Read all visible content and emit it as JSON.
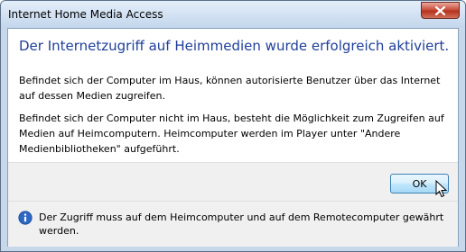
{
  "window": {
    "title": "Internet Home Media Access"
  },
  "titlebar": {
    "close_icon": "close-icon"
  },
  "main": {
    "heading": "Der Internetzugriff auf Heimmedien wurde erfolgreich aktiviert.",
    "paragraph1": "Befindet sich der Computer im Haus, können autorisierte Benutzer über das Internet auf dessen Medien zugreifen.",
    "paragraph2": "Befindet sich der Computer nicht im Haus, besteht die Möglichkeit zum Zugreifen auf Medien auf Heimcomputern. Heimcomputer werden im Player unter \"Andere Medienbibliotheken\" aufgeführt."
  },
  "buttons": {
    "ok_label": "OK"
  },
  "footer": {
    "icon": "info-icon",
    "text": "Der Zugriff muss auf dem Heimcomputer und auf dem Remotecomputer gewährt werden."
  },
  "colors": {
    "heading": "#1f3f99",
    "frame": "#c7d8ea",
    "close_button": "#c9503d"
  }
}
